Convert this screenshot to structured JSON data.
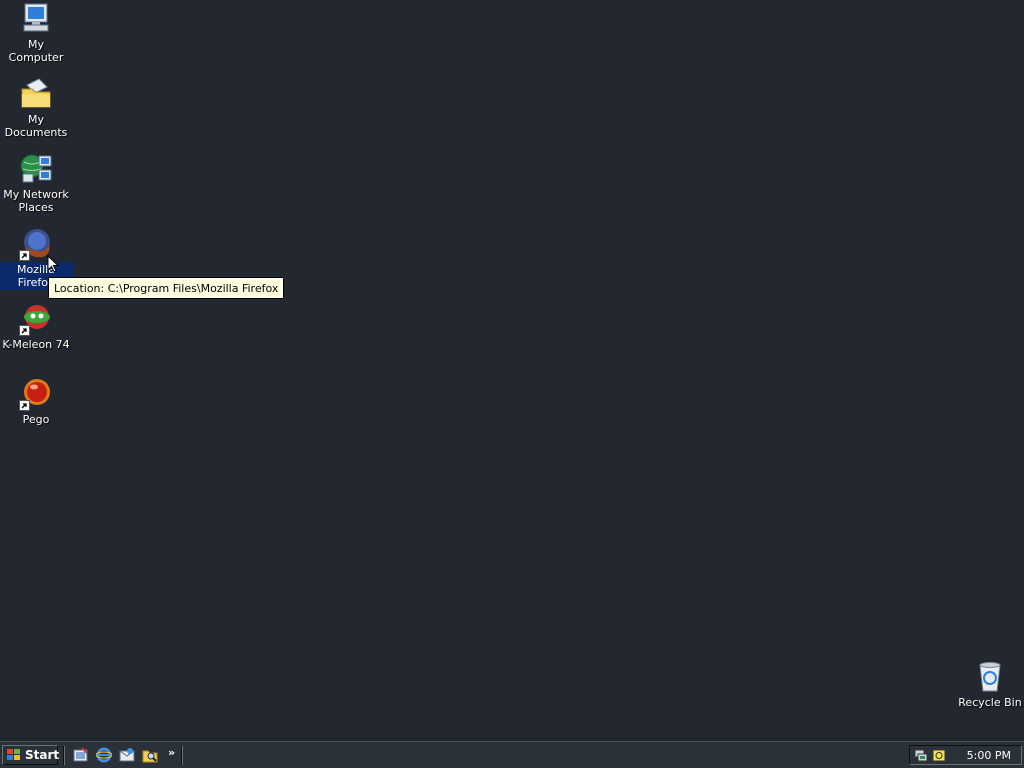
{
  "desktop": {
    "icons": [
      {
        "label": "My Computer",
        "icon": "my-computer-icon"
      },
      {
        "label": "My Documents",
        "icon": "my-documents-icon"
      },
      {
        "label": "My Network\nPlaces",
        "icon": "network-places-icon"
      },
      {
        "label": "Mozilla Firefox",
        "icon": "firefox-icon",
        "selected": true
      },
      {
        "label": "K-Meleon 74",
        "icon": "k-meleon-icon"
      },
      {
        "label": "Pego",
        "icon": "pego-icon"
      }
    ],
    "recycle_bin": {
      "label": "Recycle Bin",
      "icon": "recycle-bin-icon"
    },
    "tooltip": "Location: C:\\Program Files\\Mozilla Firefox",
    "background_color": "#232830"
  },
  "taskbar": {
    "start_label": "Start",
    "quick_launch_chevron": "»",
    "clock": "5:00 PM"
  }
}
